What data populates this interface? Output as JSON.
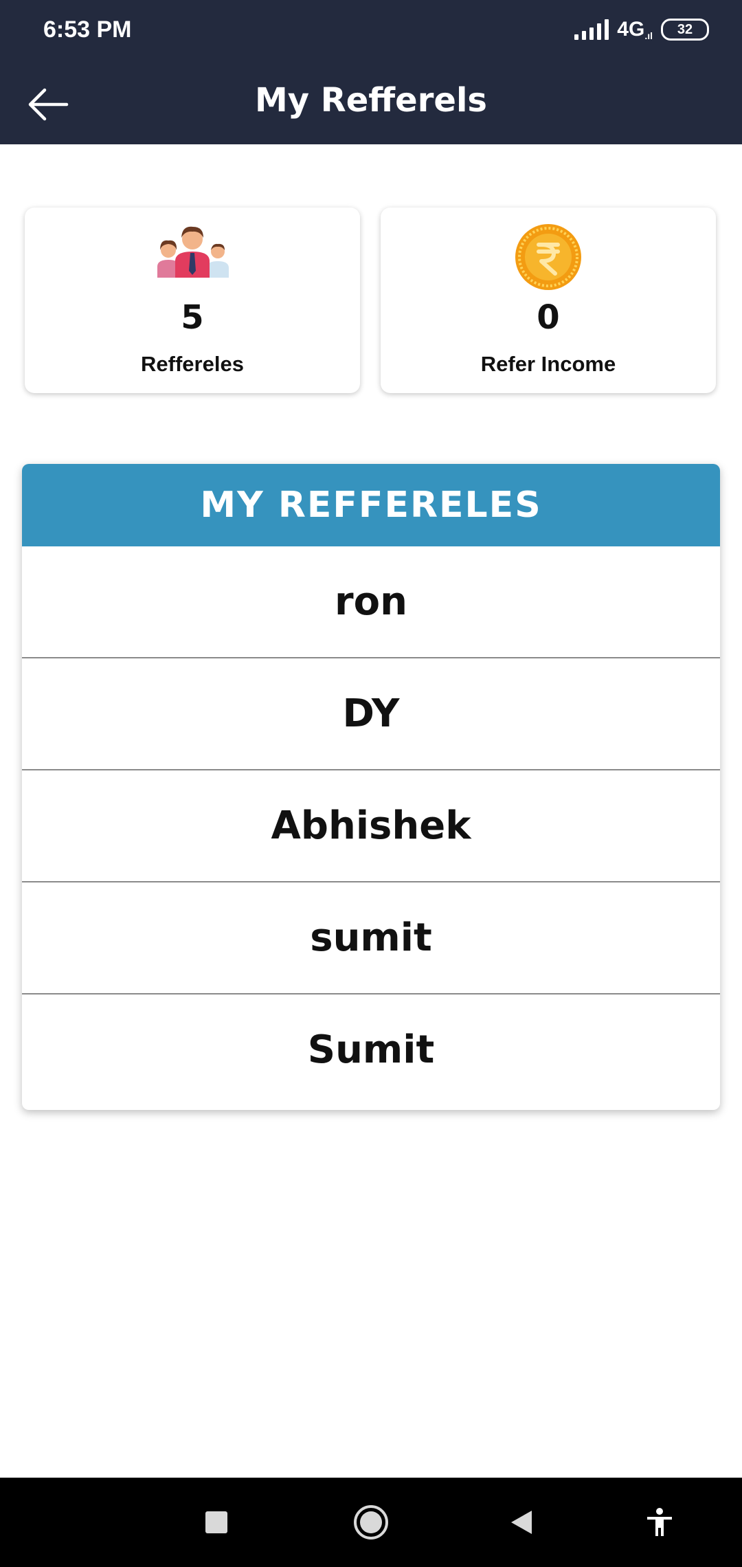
{
  "status_bar": {
    "time": "6:53 PM",
    "network": "4G",
    "battery": "32"
  },
  "app_bar": {
    "title": "My Refferels",
    "back_icon": "arrow-left-icon"
  },
  "stats": [
    {
      "icon": "people-group-icon",
      "value": "5",
      "label": "Reffereles"
    },
    {
      "icon": "rupee-coin-icon",
      "value": "0",
      "label": "Refer Income"
    }
  ],
  "referrals": {
    "header": "MY REFFERELES",
    "items": [
      "ron",
      "DY",
      "Abhishek",
      "sumit",
      "Sumit"
    ]
  },
  "nav_bar": {
    "icons": [
      "recents-square-icon",
      "home-circle-icon",
      "back-triangle-icon",
      "accessibility-icon"
    ]
  },
  "colors": {
    "app_bar": "#232a3e",
    "list_header": "#3693be",
    "coin": "#f5a623"
  }
}
